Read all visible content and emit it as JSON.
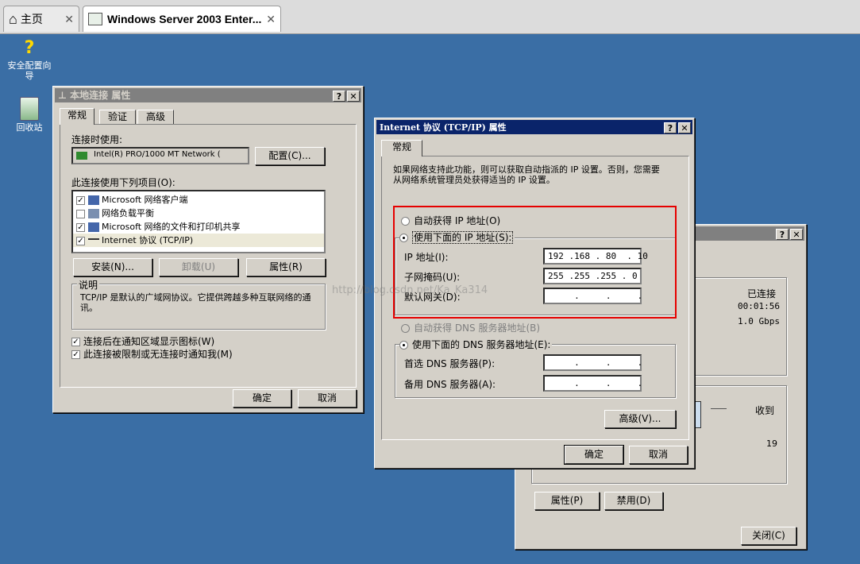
{
  "browser": {
    "tabs": [
      {
        "label": "主页",
        "icon": "home-icon"
      },
      {
        "label": "Windows Server 2003 Enter...",
        "icon": "vm-icon"
      }
    ]
  },
  "desktop": {
    "icons": [
      {
        "label": "安全配置向导",
        "icon": "security-wizard-icon"
      },
      {
        "label": "回收站",
        "icon": "recycle-bin-icon"
      }
    ]
  },
  "local_conn": {
    "title": "本地连接 属性",
    "tabs": [
      "常规",
      "验证",
      "高级"
    ],
    "connect_using_label": "连接时使用:",
    "adapter": "Intel(R) PRO/1000 MT Network (",
    "configure_btn": "配置(C)...",
    "items_label": "此连接使用下列项目(O):",
    "items": [
      {
        "checked": true,
        "label": "Microsoft 网络客户端"
      },
      {
        "checked": false,
        "label": "网络负载平衡"
      },
      {
        "checked": true,
        "label": "Microsoft 网络的文件和打印机共享"
      },
      {
        "checked": true,
        "label": "Internet 协议 (TCP/IP)"
      }
    ],
    "install_btn": "安装(N)...",
    "uninstall_btn": "卸载(U)",
    "properties_btn": "属性(R)",
    "desc_title": "说明",
    "desc_text": "TCP/IP 是默认的广域网协议。它提供跨越多种互联网络的通讯。",
    "notify_icon": "连接后在通知区域显示图标(W)",
    "notify_limited": "此连接被限制或无连接时通知我(M)",
    "ok_btn": "确定",
    "cancel_btn": "取消"
  },
  "status_win": {
    "connected": "已连接",
    "duration": "00:01:56",
    "speed": "1.0 Gbps",
    "received_label": "收到",
    "received_value": "19",
    "properties_btn": "属性(P)",
    "disable_btn": "禁用(D)",
    "close_btn": "关闭(C)"
  },
  "tcpip": {
    "title": "Internet 协议 (TCP/IP) 属性",
    "tab": "常规",
    "intro": "如果网络支持此功能，则可以获取自动指派的 IP 设置。否则，您需要从网络系统管理员处获得适当的 IP 设置。",
    "auto_ip": "自动获得 IP 地址(O)",
    "manual_ip": "使用下面的 IP 地址(S):",
    "ip_label": "IP 地址(I):",
    "ip_value": "192 .168 . 80  . 10",
    "mask_label": "子网掩码(U):",
    "mask_value": "255 .255 .255 . 0",
    "gateway_label": "默认网关(D):",
    "gateway_value": "     .     .     .",
    "auto_dns": "自动获得 DNS 服务器地址(B)",
    "manual_dns": "使用下面的 DNS 服务器地址(E):",
    "dns1_label": "首选 DNS 服务器(P):",
    "dns1_value": "     .     .     .",
    "dns2_label": "备用 DNS 服务器(A):",
    "dns2_value": "     .     .     .",
    "advanced_btn": "高级(V)...",
    "ok_btn": "确定",
    "cancel_btn": "取消"
  },
  "watermark": "http://blog.csdn.net/Ka_Ka314",
  "colors": {
    "desktop": "#3a6ea5",
    "active_title": "#0a246a",
    "highlight_box": "#e60000"
  }
}
